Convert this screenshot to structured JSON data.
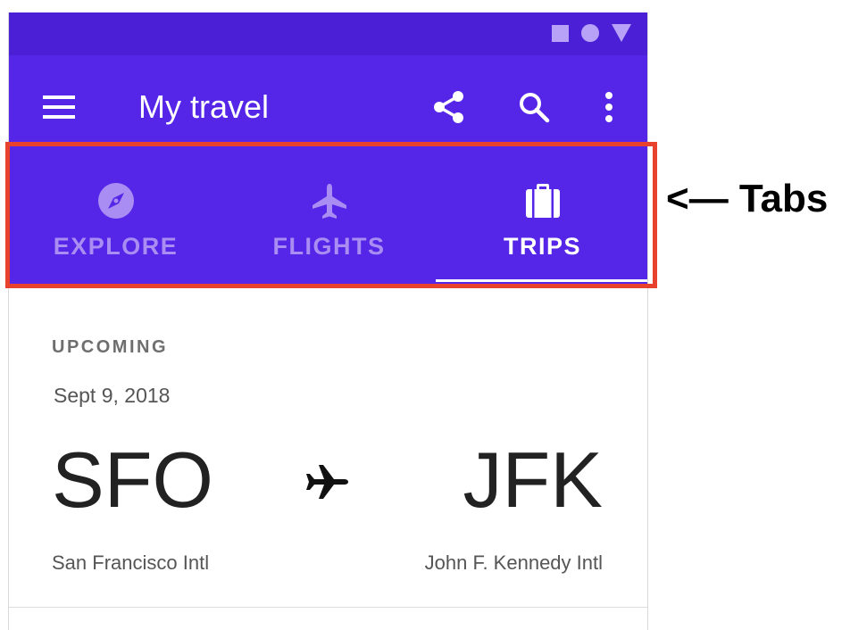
{
  "app_bar": {
    "title": "My travel",
    "color": "#5526e8",
    "status_bar_color": "#4a1fd6"
  },
  "icons": {
    "menu": "menu-icon",
    "share": "share-icon",
    "search": "search-icon",
    "more": "more-vert-icon"
  },
  "tabs": [
    {
      "label": "EXPLORE",
      "icon": "compass-icon",
      "selected": false
    },
    {
      "label": "FLIGHTS",
      "icon": "airplane-icon",
      "selected": false
    },
    {
      "label": "TRIPS",
      "icon": "briefcase-icon",
      "selected": true
    }
  ],
  "trip": {
    "section_label": "UPCOMING",
    "date": "Sept 9, 2018",
    "origin_code": "SFO",
    "origin_name": "San Francisco Intl",
    "destination_code": "JFK",
    "destination_name": "John F. Kennedy Intl"
  },
  "annotation": {
    "text": "<— Tabs",
    "highlight_color": "#e8412e"
  }
}
